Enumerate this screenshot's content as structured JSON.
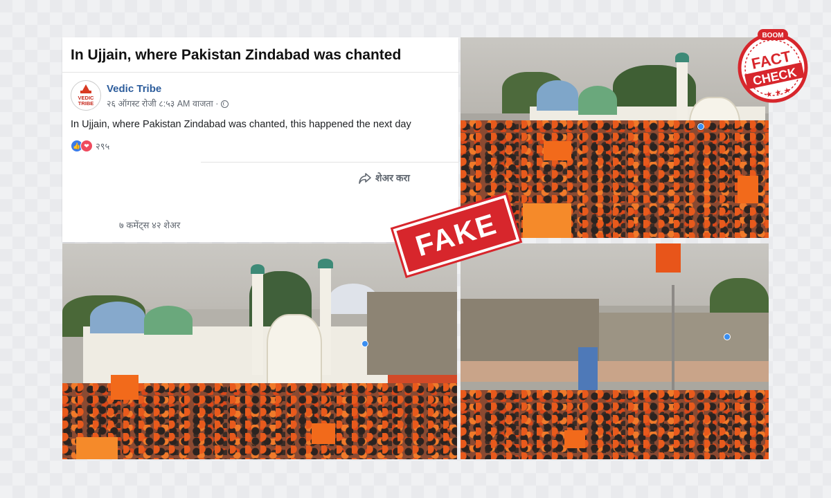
{
  "post": {
    "title": "In Ujjain, where Pakistan Zindabad was chanted",
    "author": "Vedic Tribe",
    "avatar_text_top": "VEDIC",
    "avatar_text_bottom": "TRIBE",
    "timestamp": "२६ ऑगस्ट रोजी ८:५३ AM वाजता ·",
    "body": "In Ujjain, where Pakistan Zindabad was chanted, this happened the next day",
    "reaction_count": "२९५",
    "share_label": "शेअर करा",
    "stats": "७ कमेंट्स  ४२ शेअर"
  },
  "overlay": {
    "fake_label": "FAKE",
    "badge_brand": "BOOM",
    "badge_line1": "FACT",
    "badge_line2": "CHECK"
  },
  "icons": [
    "globe-icon",
    "like-icon",
    "love-icon",
    "share-arrow-icon"
  ],
  "colors": {
    "author_link": "#2d5d9c",
    "fake_red": "#d7262c",
    "saffron": "#f26a1b",
    "like_blue": "#3b7be8",
    "love_red": "#ef4a5e"
  }
}
